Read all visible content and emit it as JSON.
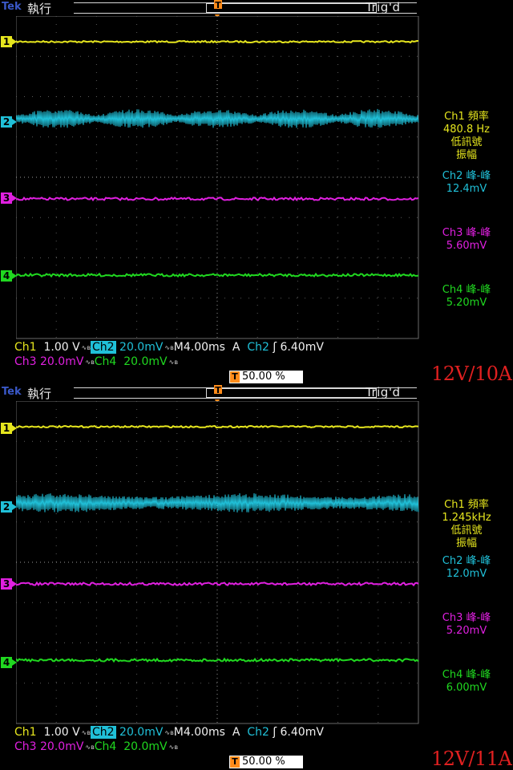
{
  "screens": [
    {
      "brand": "Tek",
      "run_state": "執行",
      "trigger_state": "Trig'd",
      "channels": [
        {
          "marker": "1",
          "color": "#e6e61e",
          "measure_label": "Ch1 頻率",
          "measure_value": "480.8 Hz",
          "extra_lines": [
            "低訊號",
            "振幅"
          ]
        },
        {
          "marker": "2",
          "color": "#20c0d8",
          "measure_label": "Ch2 峰-峰",
          "measure_value": "12.4mV"
        },
        {
          "marker": "3",
          "color": "#e020e0",
          "measure_label": "Ch3 峰-峰",
          "measure_value": "5.60mV"
        },
        {
          "marker": "4",
          "color": "#20d820",
          "measure_label": "Ch4 峰-峰",
          "measure_value": "5.20mV"
        }
      ],
      "status_row1": {
        "ch1": "Ch1",
        "ch1_scale": "1.00 V",
        "ch2": "Ch2",
        "ch2_scale": "20.0mV",
        "timebase": "M4.00ms",
        "trig_mode": "A",
        "trig_src": "Ch2",
        "trig_slope": "ʃ",
        "trig_level": "6.40mV"
      },
      "status_row2": {
        "ch3": "Ch3",
        "ch3_scale": "20.0mV",
        "ch4": "Ch4",
        "ch4_scale": "20.0mV"
      },
      "trigger_position": "50.00 %",
      "caption": "12V/10A"
    },
    {
      "brand": "Tek",
      "run_state": "執行",
      "trigger_state": "Trig'd",
      "channels": [
        {
          "marker": "1",
          "color": "#e6e61e",
          "measure_label": "Ch1 頻率",
          "measure_value": "1.245kHz",
          "extra_lines": [
            "低訊號",
            "振幅"
          ]
        },
        {
          "marker": "2",
          "color": "#20c0d8",
          "measure_label": "Ch2 峰-峰",
          "measure_value": "12.0mV"
        },
        {
          "marker": "3",
          "color": "#e020e0",
          "measure_label": "Ch3 峰-峰",
          "measure_value": "5.20mV"
        },
        {
          "marker": "4",
          "color": "#20d820",
          "measure_label": "Ch4 峰-峰",
          "measure_value": "6.00mV"
        }
      ],
      "status_row1": {
        "ch1": "Ch1",
        "ch1_scale": "1.00 V",
        "ch2": "Ch2",
        "ch2_scale": "20.0mV",
        "timebase": "M4.00ms",
        "trig_mode": "A",
        "trig_src": "Ch2",
        "trig_slope": "ʃ",
        "trig_level": "6.40mV"
      },
      "status_row2": {
        "ch3": "Ch3",
        "ch3_scale": "20.0mV",
        "ch4": "Ch4",
        "ch4_scale": "20.0mV"
      },
      "trigger_position": "50.00 %",
      "caption": "12V/11A"
    }
  ],
  "trigger_marker": "T",
  "bandwidth_icon": "bandwidth-limit-icon"
}
